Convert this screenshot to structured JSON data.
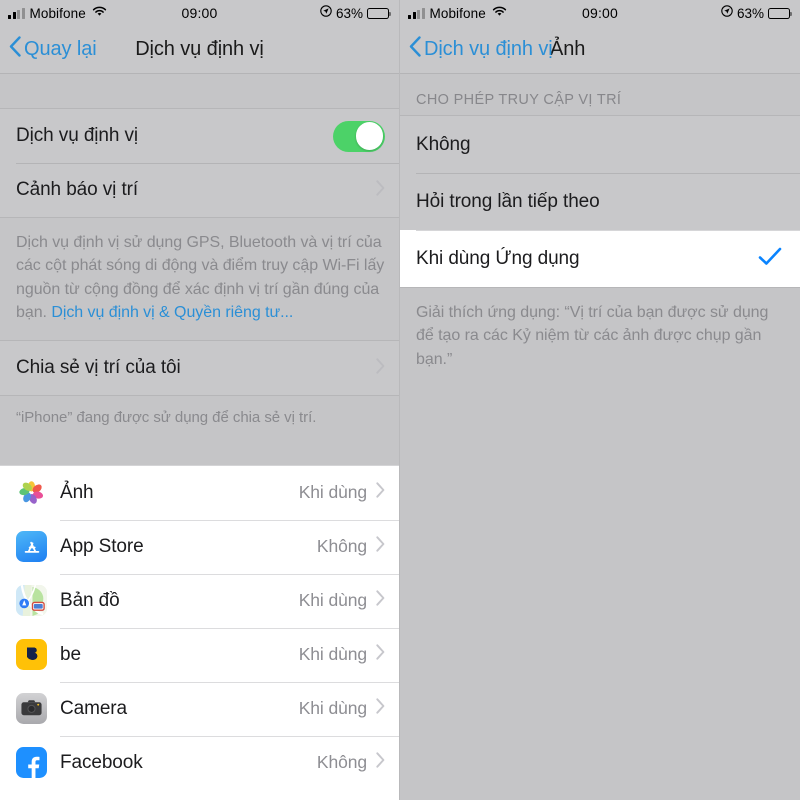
{
  "status_bar": {
    "carrier": "Mobifone",
    "time": "09:00",
    "battery_percent": "63%",
    "signal_icon": "signal-bars-icon",
    "wifi_icon": "wifi-icon",
    "location_icon": "location-arrow-icon",
    "battery_icon": "battery-icon"
  },
  "left_panel": {
    "nav": {
      "back_label": "Quay lại",
      "title": "Dịch vụ định vị",
      "back_icon": "chevron-left-icon"
    },
    "main_group": [
      {
        "label": "Dịch vụ định vị",
        "type": "toggle",
        "toggle_on": true
      },
      {
        "label": "Cảnh báo vị trí",
        "type": "disclosure"
      }
    ],
    "description": {
      "text": "Dịch vụ định vị sử dụng GPS, Bluetooth và vị trí của các cột phát sóng di động và điểm truy cập Wi-Fi lấy nguồn từ cộng đồng để xác định vị trí gần đúng của bạn. ",
      "link_text": "Dịch vụ định vị & Quyền riêng tư..."
    },
    "share_group": [
      {
        "label": "Chia sẻ vị trí của tôi",
        "type": "disclosure"
      }
    ],
    "share_note": "“iPhone” đang được sử dụng để chia sẻ vị trí.",
    "apps": [
      {
        "name": "Ảnh",
        "value": "Khi dùng",
        "icon": "photos-app-icon"
      },
      {
        "name": "App Store",
        "value": "Không",
        "icon": "app-store-app-icon"
      },
      {
        "name": "Bản đồ",
        "value": "Khi dùng",
        "icon": "maps-app-icon"
      },
      {
        "name": "be",
        "value": "Khi dùng",
        "icon": "be-app-icon"
      },
      {
        "name": "Camera",
        "value": "Khi dùng",
        "icon": "camera-app-icon"
      },
      {
        "name": "Facebook",
        "value": "Không",
        "icon": "facebook-app-icon"
      }
    ]
  },
  "right_panel": {
    "nav": {
      "back_label": "Dịch vụ định vị",
      "title": "Ảnh",
      "back_icon": "chevron-left-icon"
    },
    "section_header": "CHO PHÉP TRUY CẬP VỊ TRÍ",
    "options": [
      {
        "label": "Không",
        "selected": false
      },
      {
        "label": "Hỏi trong lần tiếp theo",
        "selected": false
      },
      {
        "label": "Khi dùng Ứng dụng",
        "selected": true
      }
    ],
    "footer_note": "Giải thích ứng dụng: “Vị trí của bạn được sử dụng để tạo ra các Kỷ niệm từ các ảnh được chụp gần bạn.”",
    "check_icon": "checkmark-icon"
  },
  "colors": {
    "accent_blue": "#0a84ff",
    "link_blue": "#2b8fd6",
    "toggle_green": "#4cd268",
    "dim_gray": "#c8c8ca"
  }
}
